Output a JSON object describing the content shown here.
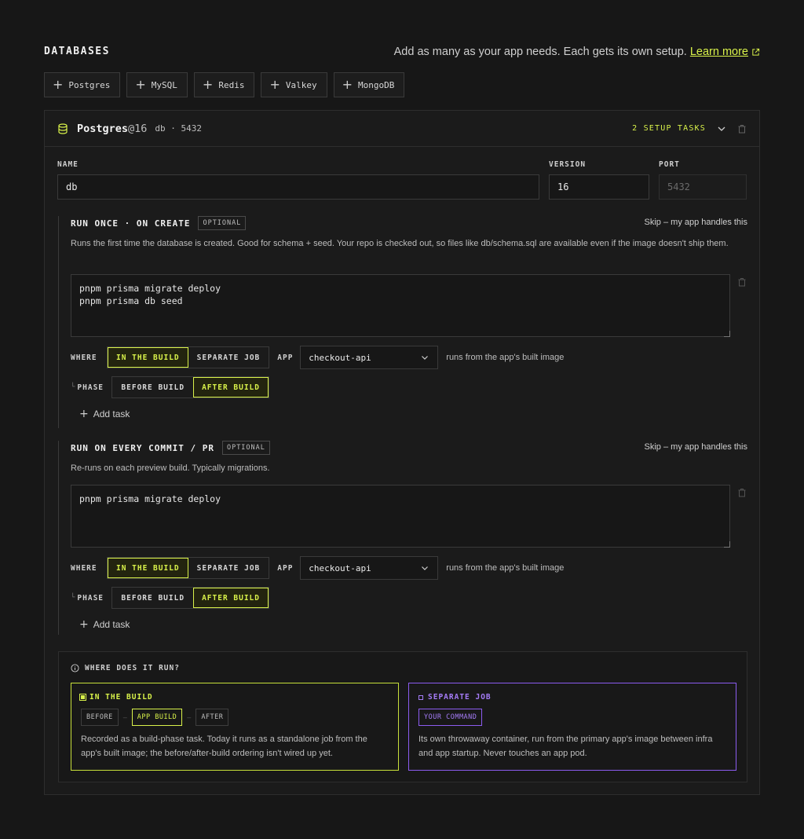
{
  "section": {
    "title": "DATABASES",
    "description": "Add as many as your app needs. Each gets its own setup.",
    "learn_more": "Learn more"
  },
  "add_buttons": [
    "Postgres",
    "MySQL",
    "Redis",
    "Valkey",
    "MongoDB"
  ],
  "database": {
    "name": "Postgres",
    "version_suffix": "@16",
    "meta": "db · 5432",
    "setup_tasks": "2 SETUP TASKS",
    "fields": {
      "name_label": "NAME",
      "name_value": "db",
      "version_label": "VERSION",
      "version_value": "16",
      "port_label": "PORT",
      "port_placeholder": "5432"
    }
  },
  "tasks": [
    {
      "title": "RUN ONCE · ON CREATE",
      "badge": "OPTIONAL",
      "skip": "Skip – my app handles this",
      "description": "Runs the first time the database is created. Good for schema + seed. Your repo is checked out, so files like db/schema.sql are available even if the image doesn't ship them.",
      "code": "pnpm prisma migrate deploy\npnpm prisma db seed",
      "where_label": "WHERE",
      "where_options": [
        "IN THE BUILD",
        "SEPARATE JOB"
      ],
      "where_selected": "IN THE BUILD",
      "app_label": "APP",
      "app_value": "checkout-api",
      "app_hint": "runs from the app's built image",
      "phase_label": "PHASE",
      "phase_options": [
        "BEFORE BUILD",
        "AFTER BUILD"
      ],
      "phase_selected": "AFTER BUILD",
      "add_task": "Add task"
    },
    {
      "title": "RUN ON EVERY COMMIT / PR",
      "badge": "OPTIONAL",
      "skip": "Skip – my app handles this",
      "description": "Re-runs on each preview build. Typically migrations.",
      "code": "pnpm prisma migrate deploy",
      "where_label": "WHERE",
      "where_options": [
        "IN THE BUILD",
        "SEPARATE JOB"
      ],
      "where_selected": "IN THE BUILD",
      "app_label": "APP",
      "app_value": "checkout-api",
      "app_hint": "runs from the app's built image",
      "phase_label": "PHASE",
      "phase_options": [
        "BEFORE BUILD",
        "AFTER BUILD"
      ],
      "phase_selected": "AFTER BUILD",
      "add_task": "Add task"
    }
  ],
  "where_runs": {
    "title": "WHERE DOES IT RUN?",
    "in_build": {
      "title": "IN THE BUILD",
      "chips": [
        "BEFORE",
        "APP BUILD",
        "AFTER"
      ],
      "description": "Recorded as a build-phase task. Today it runs as a standalone job from the app's built image; the before/after-build ordering isn't wired up yet."
    },
    "separate_job": {
      "title": "SEPARATE JOB",
      "chip": "YOUR COMMAND",
      "description": "Its own throwaway container, run from the primary app's image between infra and app startup. Never touches an app pod."
    }
  },
  "colors": {
    "background": "#171717",
    "accent": "#d9f24a",
    "purple": "#a57cf7",
    "border": "#3a3a3a"
  },
  "icons": {
    "database": "database-icon",
    "external_link": "external-link-icon",
    "chevron": "chevron-down-icon",
    "trash": "trash-icon",
    "plus": "plus-icon",
    "info": "info-icon"
  }
}
